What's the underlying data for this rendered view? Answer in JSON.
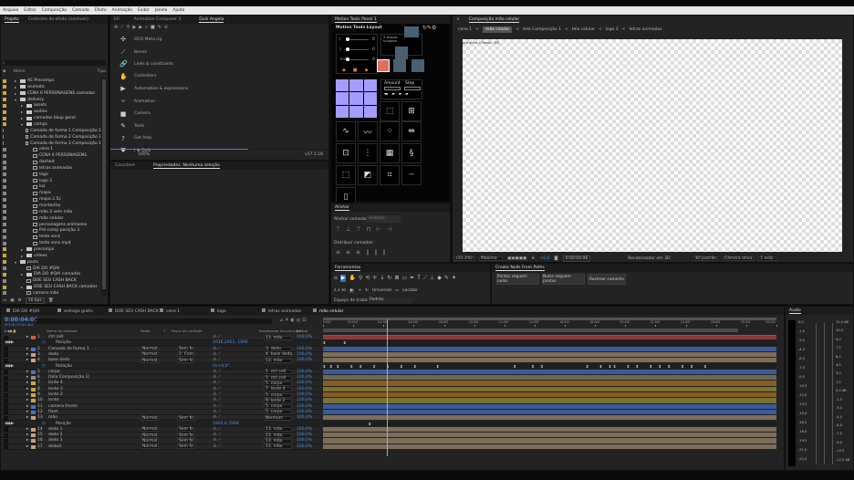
{
  "menu": [
    "Arquivo",
    "Editar",
    "Composição",
    "Camada",
    "Efeito",
    "Animação",
    "Exibir",
    "Janela",
    "Ajuda"
  ],
  "project": {
    "tabs": [
      "Projeto",
      "Controles do efeito (nenhum)"
    ],
    "search_placeholder": "",
    "col_name": "Nome",
    "col_type": "Tipo",
    "items": [
      {
        "name": "AE Precomps",
        "type": "folder",
        "level": 0,
        "open": false
      },
      {
        "name": "animatic",
        "type": "folder",
        "level": 0,
        "open": false
      },
      {
        "name": "CENA 6 PERSONAGENS camadas",
        "type": "folder",
        "level": 0,
        "open": false
      },
      {
        "name": "delivery",
        "type": "folder",
        "level": 0,
        "open": true
      },
      {
        "name": "assets",
        "type": "folder",
        "level": 1,
        "open": false
      },
      {
        "name": "audios",
        "type": "folder",
        "level": 1,
        "open": false
      },
      {
        "name": "camadas bkup geral",
        "type": "folder",
        "level": 1,
        "open": false
      },
      {
        "name": "comps",
        "type": "folder",
        "level": 1,
        "open": true
      },
      {
        "name": "Camada de forma 1 Composição 1",
        "type": "comp",
        "level": 2
      },
      {
        "name": "Camada de forma 2 Composição 1",
        "type": "comp",
        "level": 2
      },
      {
        "name": "Camada de forma 3 Composição 1",
        "type": "comp",
        "level": 2
      },
      {
        "name": "cena 1",
        "type": "comp",
        "level": 2
      },
      {
        "name": "CENA 6 PERSONAGENS",
        "type": "comp",
        "level": 2
      },
      {
        "name": "dashed",
        "type": "comp",
        "level": 2
      },
      {
        "name": "letras animadas",
        "type": "comp",
        "level": 2
      },
      {
        "name": "logo",
        "type": "comp",
        "level": 2
      },
      {
        "name": "logo 3",
        "type": "comp",
        "level": 2
      },
      {
        "name": "luz",
        "type": "comp",
        "level": 2
      },
      {
        "name": "mapa",
        "type": "comp",
        "level": 2
      },
      {
        "name": "mapa 2.5s",
        "type": "comp",
        "level": 2
      },
      {
        "name": "montanha",
        "type": "comp",
        "level": 2
      },
      {
        "name": "mão 2 sem mão",
        "type": "comp",
        "level": 2
      },
      {
        "name": "mão celular",
        "type": "comp",
        "level": 2
      },
      {
        "name": "personagens animados",
        "type": "comp",
        "level": 2
      },
      {
        "name": "Pré-comp posição 3",
        "type": "comp",
        "level": 2
      },
      {
        "name": "teste sons",
        "type": "comp",
        "level": 2
      },
      {
        "name": "teste sons.mp4",
        "type": "file",
        "level": 2
      },
      {
        "name": "precomps",
        "type": "folder",
        "level": 1,
        "open": false
      },
      {
        "name": "videos",
        "type": "folder",
        "level": 1,
        "open": false
      },
      {
        "name": "posts",
        "type": "folder",
        "level": 0,
        "open": true
      },
      {
        "name": "DIA DO #QAI",
        "type": "comp",
        "level": 1
      },
      {
        "name": "DIA DO #QAI camadas",
        "type": "folder",
        "level": 1,
        "open": false
      },
      {
        "name": "DOE SEU CASH BACK",
        "type": "comp",
        "level": 1
      },
      {
        "name": "DOE SEU CASH BACK camadas",
        "type": "folder",
        "level": 1,
        "open": false
      },
      {
        "name": "camera mão",
        "type": "comp",
        "level": 1
      }
    ],
    "bpc": "16 bpc"
  },
  "duik": {
    "tabs": [
      "Efi",
      "Animation Composer 3",
      "Duik Angela"
    ],
    "items": [
      {
        "icon": "✣",
        "label": "OCO Meta rig"
      },
      {
        "icon": "⟋",
        "label": "Bones"
      },
      {
        "icon": "🔗",
        "label": "Links & constraints"
      },
      {
        "icon": "✋",
        "label": "Controllers"
      },
      {
        "icon": "▶",
        "label": "Automation & expressions"
      },
      {
        "icon": "⑂",
        "label": "Animation"
      },
      {
        "icon": "■",
        "label": "Camera"
      },
      {
        "icon": "✎",
        "label": "Tools"
      },
      {
        "icon": "?",
        "label": "Get help"
      },
      {
        "icon": "♥",
        "label": "I ♥ Duik"
      }
    ],
    "footer_left": "100%",
    "version": "v17.1.16",
    "bottom_tabs": [
      "Caractere",
      "Propriedades: Nenhuma seleção"
    ]
  },
  "motion_tools": {
    "tab": "Motion Tools Panel 1",
    "layout": "Motion Tools Layout",
    "shapes_label": "3 shapes sculpted",
    "sliders": [
      {
        "label": "(",
        "value": "0"
      },
      {
        "label": ")",
        "value": "0"
      },
      {
        "label": "><",
        "value": "0"
      }
    ],
    "amount_label": "Amount",
    "step_label": "Step"
  },
  "align": {
    "tab": "Alinhar",
    "align_to_label": "Alinhar camadas a:",
    "align_to_value": "Seleção",
    "distribute_label": "Distribuir camadas:"
  },
  "tools": {
    "tab": "Ferramentas",
    "universal": "Universal",
    "local": "Locator",
    "workspace_label": "Espaço de trabalho:",
    "workspace_value": "Padrão"
  },
  "composition": {
    "tab": "Composição mão celular",
    "breadcrumbs": [
      "cena 1",
      "mão celular",
      "tela Composição 1",
      "tela celular",
      "logo 3",
      "letras animadas"
    ],
    "active_crumb": 1,
    "camera_label": "Câmera ativa (Classic 3D)",
    "zoom": "(33,3%)",
    "quality": "Máxima",
    "exposure": "+0,0",
    "timecode": "0:00:04:06",
    "renderer": "Renderizador em 3D",
    "view3d": "3D padrão",
    "camera": "Câmera ativa",
    "views": "1 exib."
  },
  "create_nulls": {
    "tab": "Create Nulls From Paths",
    "buttons": [
      "Pontos seguem nulos",
      "Nulos seguem pontos",
      "Rastrear caminho"
    ]
  },
  "timeline": {
    "tabs": [
      "DIA DO #QAI",
      "entrega gratis",
      "DOE SEU CASH BACK",
      "cena 1",
      "logo",
      "letras animadas",
      "mão celular"
    ],
    "active_tab": 6,
    "current_time": "0:00:04:06",
    "frame_info": "00106 (25.00 fps)",
    "headers": {
      "name": "Nome da camada",
      "mode": "Modo",
      "t": "T",
      "matte": "Fosco de controle",
      "parent": "Transformar em principal",
      "stretch": "Esticar"
    },
    "ruler": [
      "0:00f",
      "02:00f",
      "04:00f",
      "06:00f",
      "08:00f",
      "10:00f",
      "12:00f",
      "14:00f",
      "16:00f",
      "18:00f",
      "20:00f",
      "22:00f",
      "24:00f",
      "26:00f",
      "28:00f",
      "30:00f"
    ],
    "playhead_time_s": 4.25,
    "duration_s": 30,
    "rows": [
      {
        "num": "1",
        "name": "ctrl cell",
        "label": "#d0603a",
        "parent": "13. mão",
        "stretch": "100,0%",
        "bar": "#8a3a34"
      },
      {
        "prop": true,
        "name": "Posição",
        "value": "4016,2952,-1896"
      },
      {
        "num": "2",
        "name": "Camada de forma 1",
        "label": "#4a6fc7",
        "mode": "Normal",
        "matte": "Sem fo",
        "parent": "3. dedo",
        "stretch": "100,0%",
        "bar": "#3d5a95"
      },
      {
        "num": "3",
        "name": "dedo",
        "label": "#c8a27a",
        "mode": "Normal",
        "matte": "2. Cam",
        "parent": "4. base dedo",
        "stretch": "100,0%",
        "bar": "#7d6e5a"
      },
      {
        "num": "4",
        "name": "base dedo",
        "label": "#c8a27a",
        "mode": "Normal",
        "matte": "Sem fo",
        "parent": "13. mão",
        "stretch": "100,0%",
        "bar": "#7d6e5a"
      },
      {
        "prop": true,
        "name": "Rotação",
        "value": "0x+0,0°"
      },
      {
        "num": "5",
        "name": "corpo",
        "label": "#4a6fc7",
        "parent": "1. ctrl cell",
        "stretch": "100,0%",
        "bar": "#3d5a95"
      },
      {
        "num": "6",
        "name": "[tela Composição 1]",
        "label": "#9a8c7a",
        "parent": "1. ctrl cell",
        "stretch": "100,0%",
        "bar": "#6c665c"
      },
      {
        "num": "7",
        "name": "lente 4",
        "label": "#d0a640",
        "parent": "5. corpo",
        "stretch": "100,0%",
        "bar": "#8a5c22"
      },
      {
        "num": "8",
        "name": "lente 3",
        "label": "#d0a640",
        "parent": "7. lente 4",
        "stretch": "100,0%",
        "bar": "#7a7233"
      },
      {
        "num": "9",
        "name": "lente 2",
        "label": "#d0a640",
        "parent": "5. corpo",
        "stretch": "100,0%",
        "bar": "#8a5c22"
      },
      {
        "num": "10",
        "name": "lente",
        "label": "#d0a640",
        "parent": "9. lente 2",
        "stretch": "100,0%",
        "bar": "#7a7233"
      },
      {
        "num": "11",
        "name": "camera frente",
        "label": "#4a6fc7",
        "parent": "5. corpo",
        "stretch": "100,0%",
        "bar": "#3d5a95"
      },
      {
        "num": "12",
        "name": "flash",
        "label": "#4a6fc7",
        "parent": "5. corpo",
        "stretch": "100,0%",
        "bar": "#3d5a95"
      },
      {
        "num": "13",
        "name": "mão",
        "label": "#c8a27a",
        "mode": "Normal",
        "matte": "Sem fo",
        "parent": "Nenhum",
        "stretch": "100,0%",
        "bar": "#7d6e5a"
      },
      {
        "prop": true,
        "name": "Posição",
        "value": "1802,6,7968"
      },
      {
        "num": "14",
        "name": "dedo 1",
        "label": "#c8a27a",
        "mode": "Normal",
        "matte": "Sem fo",
        "parent": "13. mão",
        "stretch": "100,0%",
        "bar": "#7d6e5a"
      },
      {
        "num": "15",
        "name": "dedo 2",
        "label": "#c8a27a",
        "mode": "Normal",
        "matte": "Sem fo",
        "parent": "13. mão",
        "stretch": "100,0%",
        "bar": "#7d6e5a"
      },
      {
        "num": "16",
        "name": "dedo 3",
        "label": "#c8a27a",
        "mode": "Normal",
        "matte": "Sem fo",
        "parent": "13. mão",
        "stretch": "100,0%",
        "bar": "#7d6e5a"
      },
      {
        "num": "17",
        "name": "dedo4",
        "label": "#c8a27a",
        "mode": "Normal",
        "matte": "Sem fo",
        "parent": "13. mão",
        "stretch": "100,0%",
        "bar": "#7d6e5a"
      }
    ]
  },
  "audio": {
    "tab": "Audio",
    "left_scale": [
      "0,0",
      "-1,5",
      "-3,0",
      "-4,5",
      "-6,0",
      "-7,5",
      "-9,0",
      "-10,5",
      "-12,0",
      "-13,5",
      "-15,0",
      "-16,5",
      "-18,0",
      "-19,5",
      "-21,0",
      "-22,5"
    ],
    "right_scale": [
      "12,0 dB",
      "10,5",
      "9,0",
      "7,5",
      "6,0",
      "4,5",
      "3,0",
      "1,5",
      "0,0 dB",
      "-1,5",
      "-3,0",
      "-4,5",
      "-6,0",
      "-7,5",
      "-9,0",
      "-10,5",
      "-12,0 dB"
    ]
  }
}
